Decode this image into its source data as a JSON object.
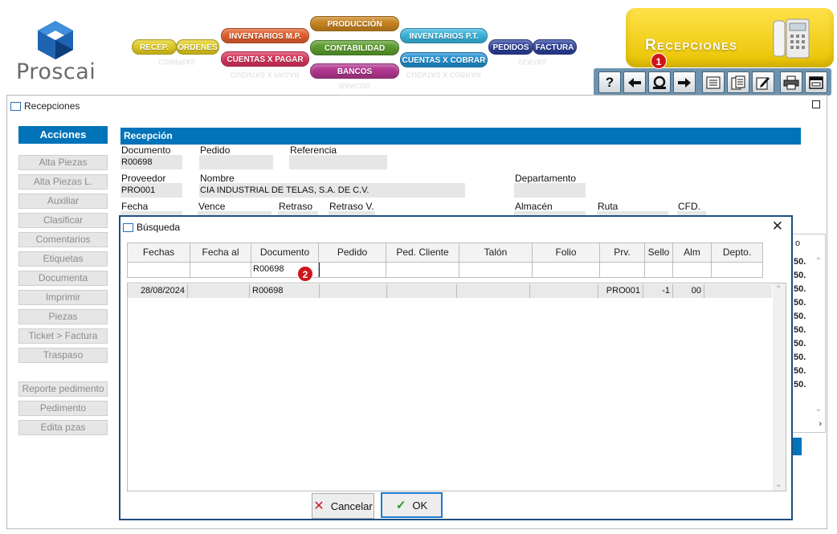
{
  "logo": {
    "text": "Proscai"
  },
  "menu": {
    "recep": "RECEP.",
    "ordenes": "ORDENES",
    "compras_reflect": "COMPRAS",
    "inventarios_mp": "INVENTARIOS M.P.",
    "cuentas_pagar": "CUENTAS X PAGAR",
    "produccion": "PRODUCCIÓN",
    "contabilidad": "CONTABILIDAD",
    "bancos": "BANCOS",
    "inventarios_pt": "INVENTARIOS P.T.",
    "cuentas_cobrar": "CUENTAS X COBRAR",
    "pedidos": "PEDIDOS",
    "factura": "FACTURA",
    "ventas_reflect": "VENTAS"
  },
  "banner": {
    "title": "Recepciones"
  },
  "badges": {
    "one": "1",
    "two": "2"
  },
  "window": {
    "title": "Recepciones"
  },
  "actions": {
    "header": "Acciones",
    "items": [
      "Alta Piezas",
      "Alta Piezas L.",
      "Auxiliar",
      "Clasificar",
      "Comentarios",
      "Etiquetas",
      "Documenta",
      "Imprimir",
      "Piezas",
      "Ticket > Factura",
      "Traspaso"
    ],
    "items2": [
      "Reporte pedimento",
      "Pedimento",
      "Edita pzas"
    ]
  },
  "reception": {
    "header": "Recepción",
    "documento_label": "Documento",
    "documento": "R00698",
    "pedido_label": "Pedido",
    "referencia_label": "Referencia",
    "proveedor_label": "Proveedor",
    "proveedor": "PRO001",
    "nombre_label": "Nombre",
    "nombre": "CIA INDUSTRIAL DE TELAS, S.A. DE C.V.",
    "departamento_label": "Departamento",
    "fecha_label": "Fecha",
    "vence_label": "Vence",
    "retraso_label": "Retraso",
    "retraso_v_label": "Retraso V.",
    "almacen_label": "Almacén",
    "ruta_label": "Ruta",
    "cfd_label": "CFD."
  },
  "background_col": {
    "header": "o",
    "cells": [
      "50.",
      "50.",
      "50.",
      "50.",
      "50.",
      "50.",
      "50.",
      "50.",
      "50.",
      "50."
    ]
  },
  "dialog": {
    "title": "Búsqueda",
    "columns": [
      "Fechas",
      "Fecha al",
      "Documento",
      "Pedido",
      "Ped. Cliente",
      "Talón",
      "Folio",
      "Prv.",
      "Sello",
      "Alm",
      "Depto."
    ],
    "filter_documento": "R00698",
    "row": {
      "fecha": "28/08/2024",
      "documento": "R00698",
      "prv": "PRO001",
      "sello": "-1",
      "alm": "00"
    },
    "cancel": "Cancelar",
    "ok": "OK"
  }
}
